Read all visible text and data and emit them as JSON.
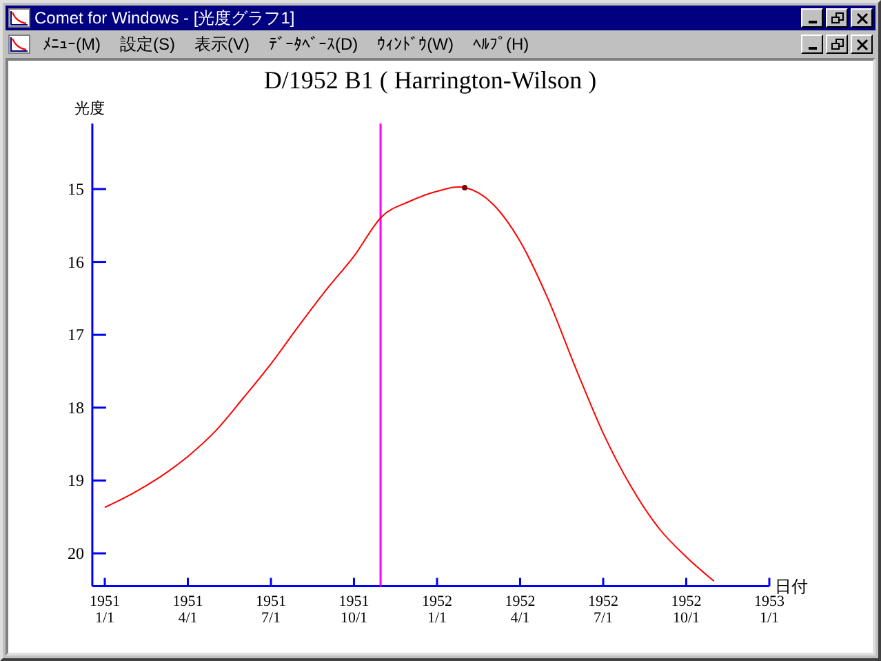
{
  "window": {
    "title": "Comet for Windows - [光度グラフ1]"
  },
  "menu": [
    "ﾒﾆｭｰ(M)",
    "設定(S)",
    "表示(V)",
    "ﾃﾞｰﾀﾍﾞｰｽ(D)",
    "ｳｨﾝﾄﾞｳ(W)",
    "ﾍﾙﾌﾟ(H)"
  ],
  "graph": {
    "chart_data": {
      "type": "line",
      "title": "D/1952 B1 ( Harrington-Wilson )",
      "xlabel": "日付",
      "ylabel": "光度",
      "categories": [
        "1951 1/1",
        null,
        null,
        "1951 4/1",
        null,
        null,
        "1951 7/1",
        null,
        null,
        "1951 10/1",
        null,
        null,
        "1952 1/1",
        null,
        null,
        "1952 4/1",
        null,
        null,
        "1952 7/1",
        null,
        null,
        "1952 10/1",
        null,
        null,
        "1953 1/1"
      ],
      "series": [
        {
          "color": "#ff0000",
          "values": [
            19.37,
            19.18,
            18.95,
            18.67,
            18.32,
            17.87,
            17.4,
            16.88,
            16.38,
            15.92,
            15.38,
            15.17,
            15.03,
            14.98,
            15.2,
            15.72,
            16.5,
            17.45,
            18.35,
            19.08,
            19.65,
            20.05,
            20.38,
            null,
            null
          ]
        }
      ],
      "ylim": [
        20.45,
        14.1
      ],
      "yticks": [
        15,
        16,
        17,
        18,
        19,
        20
      ]
    }
  }
}
